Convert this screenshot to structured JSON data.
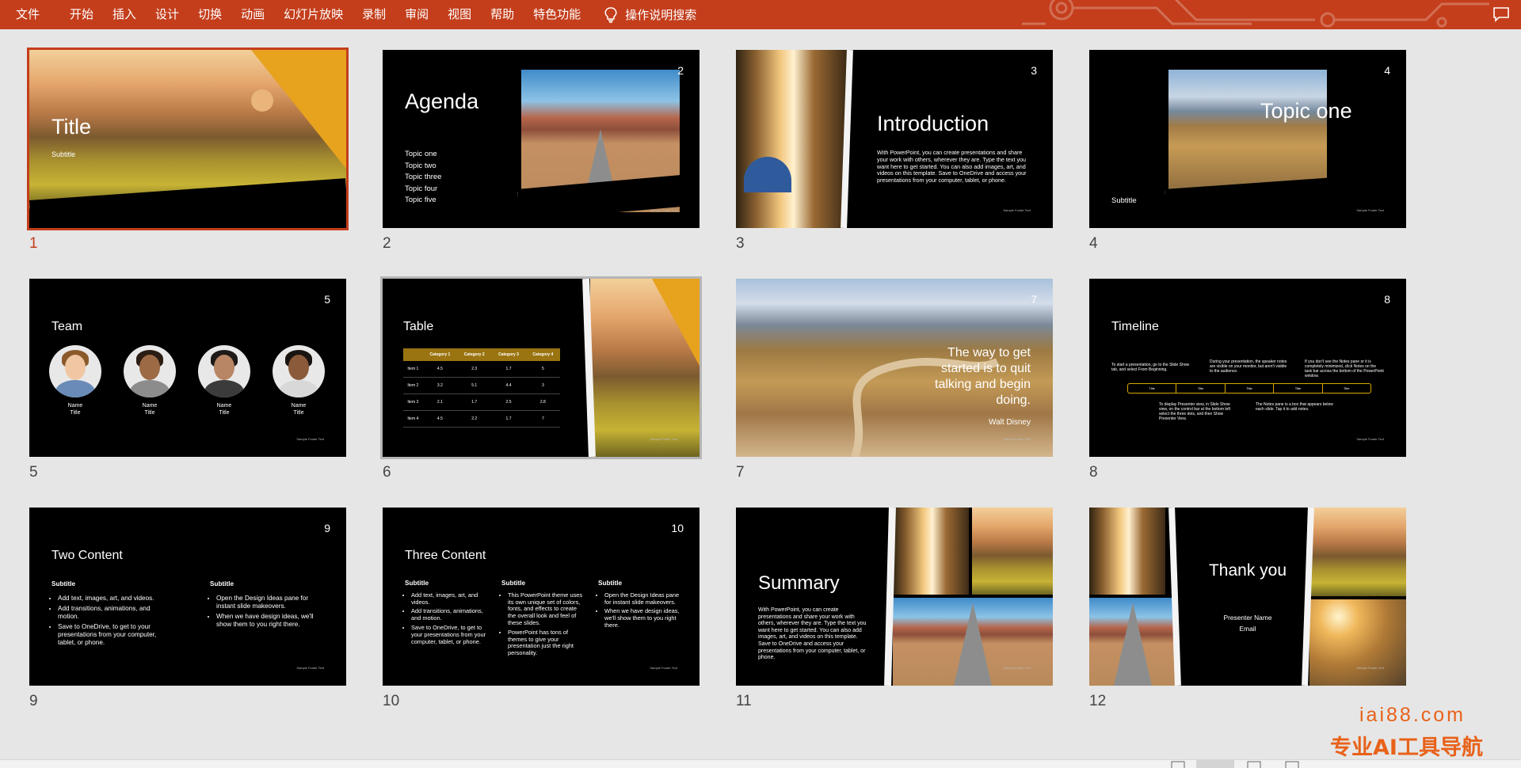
{
  "ribbon": {
    "menu": [
      "文件",
      "开始",
      "插入",
      "设计",
      "切换",
      "动画",
      "幻灯片放映",
      "录制",
      "审阅",
      "视图",
      "帮助",
      "特色功能"
    ],
    "tell_me": "操作说明搜索"
  },
  "slides": [
    {
      "number": "1",
      "title": "Title",
      "subtitle": "Subtitle"
    },
    {
      "number": "2",
      "page": "2",
      "title": "Agenda",
      "items": [
        "Topic one",
        "Topic two",
        "Topic three",
        "Topic four",
        "Topic five"
      ],
      "footer": "Sample Footer Text"
    },
    {
      "number": "3",
      "page": "3",
      "title": "Introduction",
      "body": "With PowerPoint, you can create presentations and share your work with others, wherever they are. Type the text you want here to get started. You can also add images, art, and videos on this template. Save to OneDrive and access your presentations from your computer, tablet, or phone.",
      "footer": "Sample Footer Text"
    },
    {
      "number": "4",
      "page": "4",
      "title": "Topic one",
      "subtitle": "Subtitle",
      "footer": "Sample Footer Text"
    },
    {
      "number": "5",
      "page": "5",
      "title": "Team",
      "members": [
        {
          "name": "Name",
          "role": "Title"
        },
        {
          "name": "Name",
          "role": "Title"
        },
        {
          "name": "Name",
          "role": "Title"
        },
        {
          "name": "Name",
          "role": "Title"
        }
      ],
      "footer": "Sample Footer Text"
    },
    {
      "number": "6",
      "title": "Table",
      "headers": [
        "",
        "Category 1",
        "Category 2",
        "Category 3",
        "Category 4"
      ],
      "rows": [
        [
          "Item 1",
          "4.5",
          "2.3",
          "1.7",
          "5"
        ],
        [
          "Item 2",
          "3.2",
          "5.1",
          "4.4",
          "3"
        ],
        [
          "Item 3",
          "2.1",
          "1.7",
          "2.5",
          "2.8"
        ],
        [
          "Item 4",
          "4.5",
          "2.2",
          "1.7",
          "7"
        ]
      ],
      "footer": "Sample Footer Text"
    },
    {
      "number": "7",
      "page": "7",
      "quote": "The way to get started is to quit talking and begin doing.",
      "author": "Walt Disney",
      "footer": "Sample Footer Text"
    },
    {
      "number": "8",
      "page": "8",
      "title": "Timeline",
      "top": [
        "To start a presentation, go to the Slide Show tab, and select From Beginning.",
        "During your presentation, the speaker notes are visible on your monitor, but aren't visible to the audience.",
        "If you don't see the Notes pane or it is completely minimized, click Notes on the task bar across the bottom of the PowerPoint window."
      ],
      "bottom": [
        "To display Presenter view, in Slide Show view, on the control bar at the bottom left select the three dots, and then Show Presenter View.",
        "The Notes pane is a box that appears below each slide. Tap it to add notes."
      ],
      "labels": [
        "Title",
        "Title",
        "Title",
        "Title",
        "Title"
      ],
      "footer": "Sample Footer Text"
    },
    {
      "number": "9",
      "page": "9",
      "title": "Two Content",
      "left": {
        "subtitle": "Subtitle",
        "bullets": [
          "Add text, images, art, and videos.",
          "Add transitions, animations, and motion.",
          "Save to OneDrive, to get to your presentations from your computer, tablet, or phone."
        ]
      },
      "right": {
        "subtitle": "Subtitle",
        "bullets": [
          "Open the Design Ideas pane for instant slide makeovers.",
          "When we have design ideas, we'll show them to you right there."
        ]
      },
      "footer": "Sample Footer Text"
    },
    {
      "number": "10",
      "page": "10",
      "title": "Three Content",
      "c1": {
        "subtitle": "Subtitle",
        "bullets": [
          "Add text, images, art, and videos.",
          "Add transitions, animations, and motion.",
          "Save to OneDrive, to get to your presentations from your computer, tablet, or phone."
        ]
      },
      "c2": {
        "subtitle": "Subtitle",
        "bullets": [
          "This PowerPoint theme uses its own unique set of colors, fonts, and effects to create the overall look and feel of these slides.",
          "PowerPoint has tons of themes to give your presentation just the right personality."
        ]
      },
      "c3": {
        "subtitle": "Subtitle",
        "bullets": [
          "Open the Design Ideas pane for instant slide makeovers.",
          "When we have design ideas, we'll show them to you right there."
        ]
      },
      "footer": "Sample Footer Text"
    },
    {
      "number": "11",
      "title": "Summary",
      "body": "With PowerPoint, you can create presentations and share your work with others, wherever they are. Type the text you want here to get started. You can also add images, art, and videos on this template. Save to OneDrive and access your presentations from your computer, tablet, or phone.",
      "footer": "Sample Footer Text"
    },
    {
      "number": "12",
      "title": "Thank you",
      "presenter": "Presenter Name",
      "email": "Email",
      "footer": "Sample Footer Text"
    }
  ],
  "watermark": {
    "domain": "iai88.com",
    "tagline": "专业AI工具导航"
  },
  "colors": {
    "ribbon": "#c43e1c",
    "selection": "#c43e1c",
    "accent_gold": "#9a7411"
  }
}
